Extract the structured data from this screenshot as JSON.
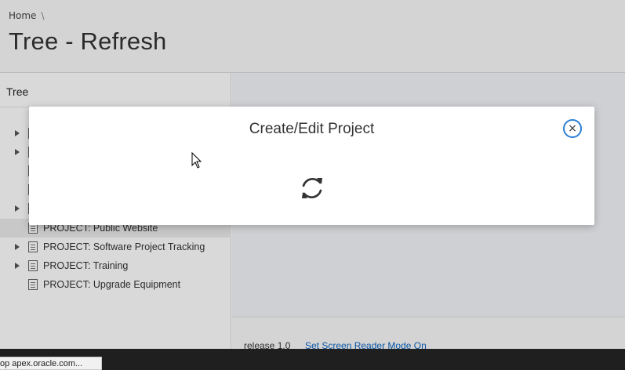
{
  "breadcrumb": {
    "home": "Home",
    "separator": "\\"
  },
  "page": {
    "title": "Tree - Refresh"
  },
  "tree": {
    "region_title": "Tree",
    "nodes": [
      {
        "label": "",
        "has_children": true
      },
      {
        "label": "",
        "has_children": true
      },
      {
        "label": "",
        "has_children": false
      },
      {
        "label": "",
        "has_children": false
      },
      {
        "label": "",
        "has_children": true
      },
      {
        "label": "PROJECT: Public Website",
        "has_children": false
      },
      {
        "label": "PROJECT: Software Project Tracking",
        "has_children": true
      },
      {
        "label": "PROJECT: Training",
        "has_children": true
      },
      {
        "label": "PROJECT: Upgrade Equipment",
        "has_children": false
      }
    ]
  },
  "footer": {
    "release": "release 1.0",
    "screen_reader_link": "Set Screen Reader Mode On"
  },
  "dialog": {
    "title": "Create/Edit Project",
    "close_glyph": "×",
    "state": "loading"
  },
  "status_bar": {
    "url": "op apex.oracle.com..."
  },
  "colors": {
    "accent": "#2a7fd4",
    "link": "#0a64c2"
  }
}
